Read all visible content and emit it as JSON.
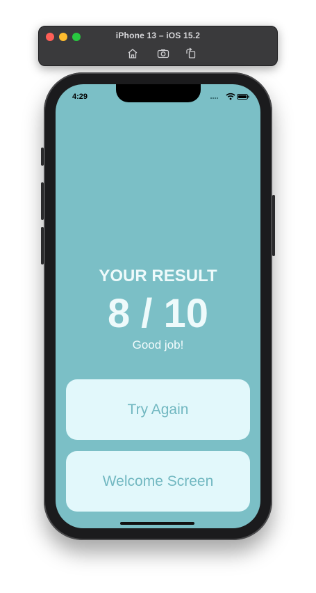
{
  "simulator": {
    "title": "iPhone 13 – iOS 15.2",
    "window_controls": [
      "close",
      "minimize",
      "zoom"
    ],
    "toolbar_icons": [
      "home-icon",
      "screenshot-icon",
      "rotate-icon"
    ]
  },
  "status_bar": {
    "time": "4:29",
    "icons": [
      "signal-icon",
      "wifi-icon",
      "battery-icon"
    ]
  },
  "result": {
    "title": "YOUR RESULT",
    "score": "8 / 10",
    "message": "Good job!"
  },
  "buttons": {
    "try_again": "Try Again",
    "welcome_screen": "Welcome Screen"
  },
  "colors": {
    "screen_background": "#7bbfc6",
    "button_background": "#e2f8fb",
    "button_text": "#72b8c1",
    "heading_text": "#eefafb"
  }
}
